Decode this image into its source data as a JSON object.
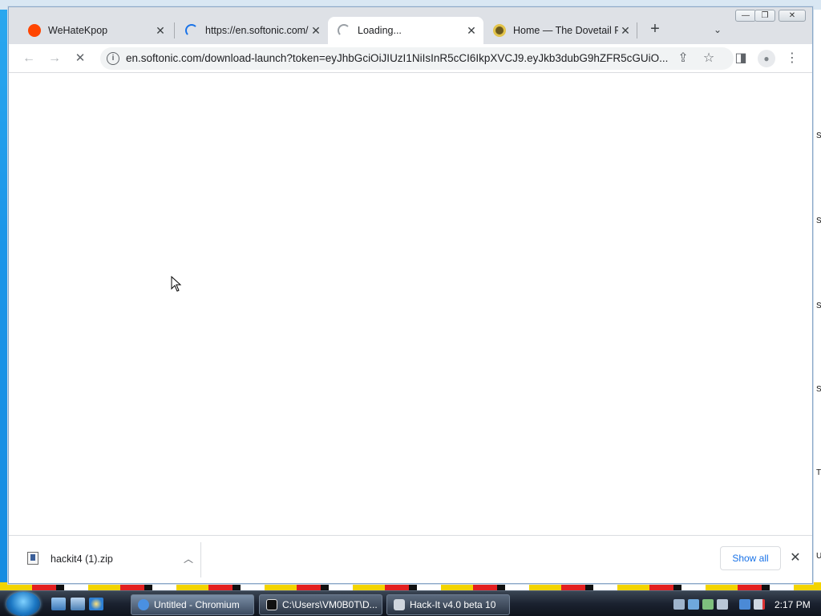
{
  "browser": {
    "app_name": "Chromium",
    "tabs": [
      {
        "title": "WeHateKpop",
        "favicon": "reddit-icon",
        "favicon_color": "#ff4500",
        "active": false
      },
      {
        "title": "https://en.softonic.com/",
        "favicon": "loading-spinner-icon",
        "favicon_color": "#1a73e8",
        "active": false
      },
      {
        "title": "Loading...",
        "favicon": "loading-spinner-icon",
        "favicon_color": "#9aa0a6",
        "active": true
      },
      {
        "title": "Home — The Dovetail P",
        "favicon": "dovetail-icon",
        "favicon_color": "#6b5a1e",
        "active": false
      }
    ],
    "new_tab_glyph": "+",
    "tab_list_glyph": "⌄",
    "window_controls": {
      "minimize": "—",
      "maximize": "❐",
      "close": "✕"
    },
    "toolbar": {
      "back_glyph": "←",
      "forward_glyph": "→",
      "stop_glyph": "✕",
      "url": "en.softonic.com/download-launch?token=eyJhbGciOiJIUzI1NiIsInR5cCI6IkpXVCJ9.eyJkb3dubG9hZFR5cGUiO...",
      "info_glyph": "i",
      "share_glyph": "⇪",
      "bookmark_glyph": "☆",
      "sidepanel_glyph": "◨",
      "profile_glyph": "●",
      "menu_glyph": "⋮"
    },
    "download_bar": {
      "file_name": "hackit4 (1).zip",
      "caret_glyph": "︿",
      "show_all_label": "Show all",
      "close_glyph": "✕"
    }
  },
  "taskbar": {
    "items": [
      {
        "label": "Untitled - Chromium",
        "icon": "chromium-icon",
        "icon_color": "#4a90e2",
        "active": true
      },
      {
        "label": "C:\\Users\\VM0B0T\\D...",
        "icon": "7zip-icon",
        "icon_color": "#111111",
        "active": false
      },
      {
        "label": "Hack-It v4.0 beta 10",
        "icon": "window-icon",
        "icon_color": "#d0d6de",
        "active": false
      }
    ],
    "clock": "2:17 PM"
  },
  "desktop": {
    "right_edge_letters": [
      "S",
      "S",
      "S",
      "S",
      "T",
      "U"
    ]
  }
}
